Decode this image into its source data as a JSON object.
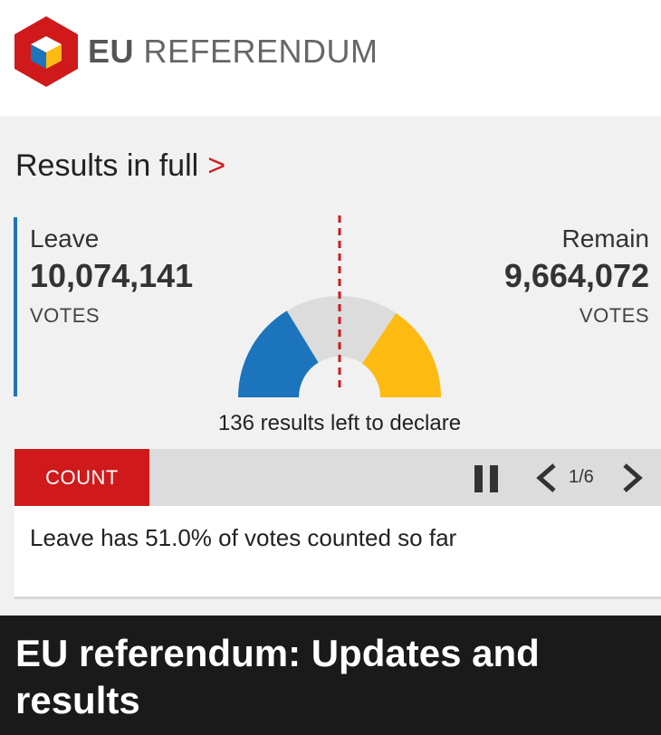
{
  "header": {
    "brand_bold": "EU",
    "brand_light": "REFERENDUM",
    "logo_icon": "eu-referendum-cube-logo"
  },
  "results": {
    "link_label": "Results in full",
    "link_chevron": ">",
    "leave": {
      "label": "Leave",
      "votes": "10,074,141",
      "unit": "VOTES",
      "color": "#1c75bc"
    },
    "remain": {
      "label": "Remain",
      "votes": "9,664,072",
      "unit": "VOTES",
      "color": "#fdbb12"
    },
    "gauge": {
      "leave_share": 0.326,
      "remain_share": 0.312,
      "undeclared_color": "#dcdcdc",
      "midline_color": "#d0191b"
    },
    "left_to_declare": "136 results left to declare"
  },
  "count_bar": {
    "tab_label": "COUNT",
    "page_indicator": "1/6",
    "accent": "#d0191b"
  },
  "summary": {
    "text": "Leave has 51.0% of votes counted so far"
  },
  "headline": {
    "text": "EU referendum: Updates and results"
  }
}
